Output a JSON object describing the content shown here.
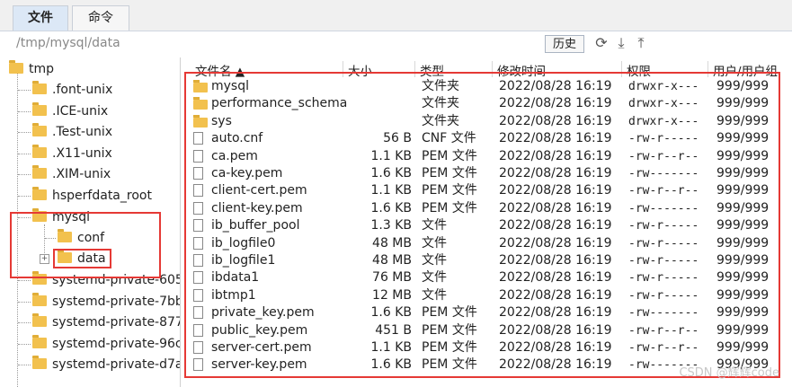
{
  "tabs": [
    {
      "label": "文件",
      "active": true
    },
    {
      "label": "命令",
      "active": false
    }
  ],
  "path": "/tmp/mysql/data",
  "history_label": "历史",
  "toolbar_icons": [
    "refresh-icon",
    "download-icon",
    "upload-icon"
  ],
  "tree": {
    "root": "tmp",
    "items": [
      ".font-unix",
      ".ICE-unix",
      ".Test-unix",
      ".X11-unix",
      ".XIM-unix",
      "hsperfdata_root"
    ],
    "mysql": "mysql",
    "mysql_children": [
      "conf",
      "data"
    ],
    "after": [
      "systemd-private-605",
      "systemd-private-7bb",
      "systemd-private-877",
      "systemd-private-96c",
      "systemd-private-d7a"
    ]
  },
  "columns": {
    "name": "文件名 ▲",
    "size": "大小",
    "type": "类型",
    "mtime": "修改时间",
    "perm": "权限",
    "owner": "用户/用户组"
  },
  "files": [
    {
      "name": "mysql",
      "size": "",
      "type": "文件夹",
      "mtime": "2022/08/28 16:19",
      "perm": "drwxr-x---",
      "owner": "999/999",
      "dir": true
    },
    {
      "name": "performance_schema",
      "size": "",
      "type": "文件夹",
      "mtime": "2022/08/28 16:19",
      "perm": "drwxr-x---",
      "owner": "999/999",
      "dir": true
    },
    {
      "name": "sys",
      "size": "",
      "type": "文件夹",
      "mtime": "2022/08/28 16:19",
      "perm": "drwxr-x---",
      "owner": "999/999",
      "dir": true
    },
    {
      "name": "auto.cnf",
      "size": "56 B",
      "type": "CNF 文件",
      "mtime": "2022/08/28 16:19",
      "perm": "-rw-r-----",
      "owner": "999/999",
      "dir": false
    },
    {
      "name": "ca.pem",
      "size": "1.1 KB",
      "type": "PEM 文件",
      "mtime": "2022/08/28 16:19",
      "perm": "-rw-r--r--",
      "owner": "999/999",
      "dir": false
    },
    {
      "name": "ca-key.pem",
      "size": "1.6 KB",
      "type": "PEM 文件",
      "mtime": "2022/08/28 16:19",
      "perm": "-rw-------",
      "owner": "999/999",
      "dir": false
    },
    {
      "name": "client-cert.pem",
      "size": "1.1 KB",
      "type": "PEM 文件",
      "mtime": "2022/08/28 16:19",
      "perm": "-rw-r--r--",
      "owner": "999/999",
      "dir": false
    },
    {
      "name": "client-key.pem",
      "size": "1.6 KB",
      "type": "PEM 文件",
      "mtime": "2022/08/28 16:19",
      "perm": "-rw-------",
      "owner": "999/999",
      "dir": false
    },
    {
      "name": "ib_buffer_pool",
      "size": "1.3 KB",
      "type": "文件",
      "mtime": "2022/08/28 16:19",
      "perm": "-rw-r-----",
      "owner": "999/999",
      "dir": false
    },
    {
      "name": "ib_logfile0",
      "size": "48 MB",
      "type": "文件",
      "mtime": "2022/08/28 16:19",
      "perm": "-rw-r-----",
      "owner": "999/999",
      "dir": false
    },
    {
      "name": "ib_logfile1",
      "size": "48 MB",
      "type": "文件",
      "mtime": "2022/08/28 16:19",
      "perm": "-rw-r-----",
      "owner": "999/999",
      "dir": false
    },
    {
      "name": "ibdata1",
      "size": "76 MB",
      "type": "文件",
      "mtime": "2022/08/28 16:19",
      "perm": "-rw-r-----",
      "owner": "999/999",
      "dir": false
    },
    {
      "name": "ibtmp1",
      "size": "12 MB",
      "type": "文件",
      "mtime": "2022/08/28 16:19",
      "perm": "-rw-r-----",
      "owner": "999/999",
      "dir": false
    },
    {
      "name": "private_key.pem",
      "size": "1.6 KB",
      "type": "PEM 文件",
      "mtime": "2022/08/28 16:19",
      "perm": "-rw-------",
      "owner": "999/999",
      "dir": false
    },
    {
      "name": "public_key.pem",
      "size": "451 B",
      "type": "PEM 文件",
      "mtime": "2022/08/28 16:19",
      "perm": "-rw-r--r--",
      "owner": "999/999",
      "dir": false
    },
    {
      "name": "server-cert.pem",
      "size": "1.1 KB",
      "type": "PEM 文件",
      "mtime": "2022/08/28 16:19",
      "perm": "-rw-r--r--",
      "owner": "999/999",
      "dir": false
    },
    {
      "name": "server-key.pem",
      "size": "1.6 KB",
      "type": "PEM 文件",
      "mtime": "2022/08/28 16:19",
      "perm": "-rw-------",
      "owner": "999/999",
      "dir": false
    }
  ],
  "watermark": "CSDN @辉辉code",
  "colors": {
    "highlight_box": "#e53935",
    "folder": "#f2c14e",
    "active_tab": "#dce8f6"
  }
}
